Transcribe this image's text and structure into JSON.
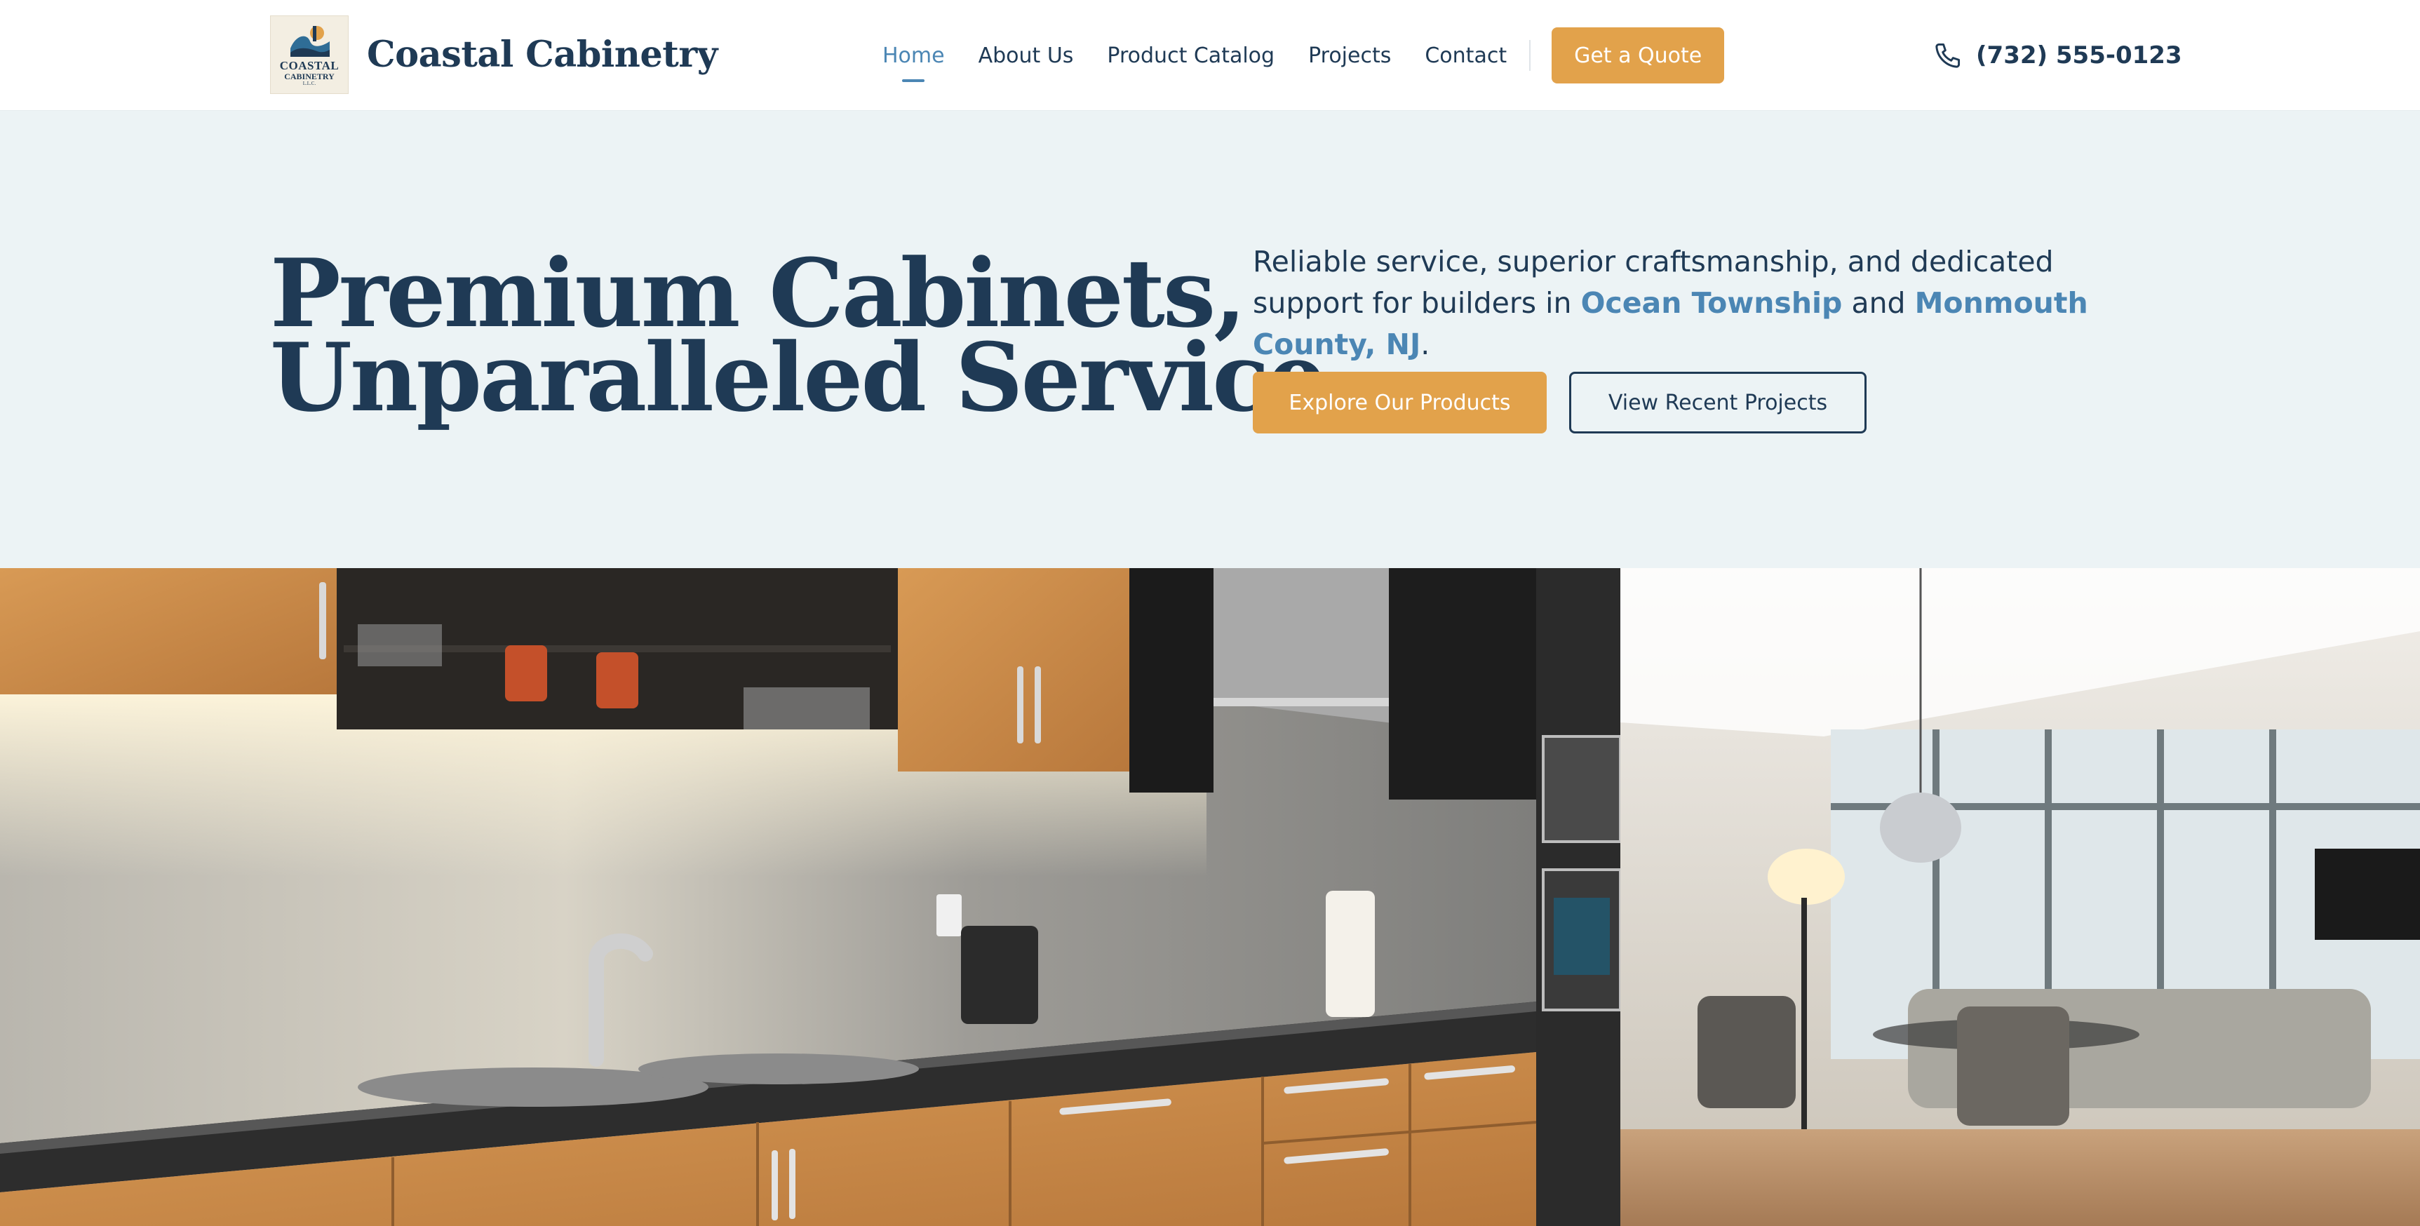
{
  "brand": {
    "name": "Coastal Cabinetry",
    "logo_line1": "COASTAL",
    "logo_line2": "CABINETRY",
    "logo_line3": "L.L.C."
  },
  "nav": {
    "items": [
      {
        "label": "Home",
        "active": true
      },
      {
        "label": "About Us",
        "active": false
      },
      {
        "label": "Product Catalog",
        "active": false
      },
      {
        "label": "Projects",
        "active": false
      },
      {
        "label": "Contact",
        "active": false
      }
    ],
    "quote_button": "Get a Quote",
    "phone": "(732) 555-0123"
  },
  "hero": {
    "title_line1": "Premium Cabinets,",
    "title_line2": "Unparalleled Service.",
    "sub_text_1": "Reliable service, superior craftsmanship, and dedicated support for builders in ",
    "sub_highlight_1": "Ocean Township",
    "sub_text_2": " and ",
    "sub_highlight_2": "Monmouth County, NJ",
    "sub_text_3": ".",
    "primary_button": "Explore Our Products",
    "secondary_button": "View Recent Projects"
  },
  "colors": {
    "navy": "#1f3a55",
    "accent_blue": "#4b86b4",
    "gold": "#e2a24b",
    "hero_bg": "#ecf3f5"
  },
  "icons": {
    "phone": "phone-icon",
    "logo": "lighthouse-wave-logo"
  }
}
